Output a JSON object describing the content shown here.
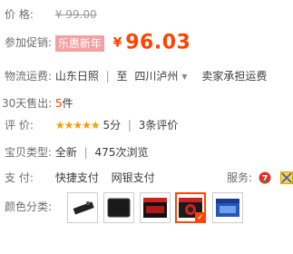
{
  "price": {
    "label": "价    格:",
    "value": "¥ 99.00"
  },
  "promo": {
    "label": "参加促销:",
    "badge": "乐惠新年",
    "currency": "¥",
    "value": "96.03"
  },
  "shipping": {
    "label": "物流运费:",
    "from": "山东日照",
    "sep": "|",
    "to_prefix": "至",
    "to": "四川泸州",
    "fee": "卖家承担运费"
  },
  "sales": {
    "label": "30天售出:",
    "count": "5",
    "unit": "件"
  },
  "rating": {
    "label": "评    价:",
    "stars": "★★★★★",
    "score": "5分",
    "sep": "|",
    "reviews": "3条评价"
  },
  "type": {
    "label": "宝贝类型:",
    "condition": "全新",
    "sep": "|",
    "views": "475次浏览"
  },
  "payment": {
    "label": "支    付:",
    "method1": "快捷支付",
    "method2": "网银支付",
    "service_label": "服务:"
  },
  "colors": {
    "label": "颜色分类:",
    "selected_index": 3
  },
  "accent": "#ff4400"
}
